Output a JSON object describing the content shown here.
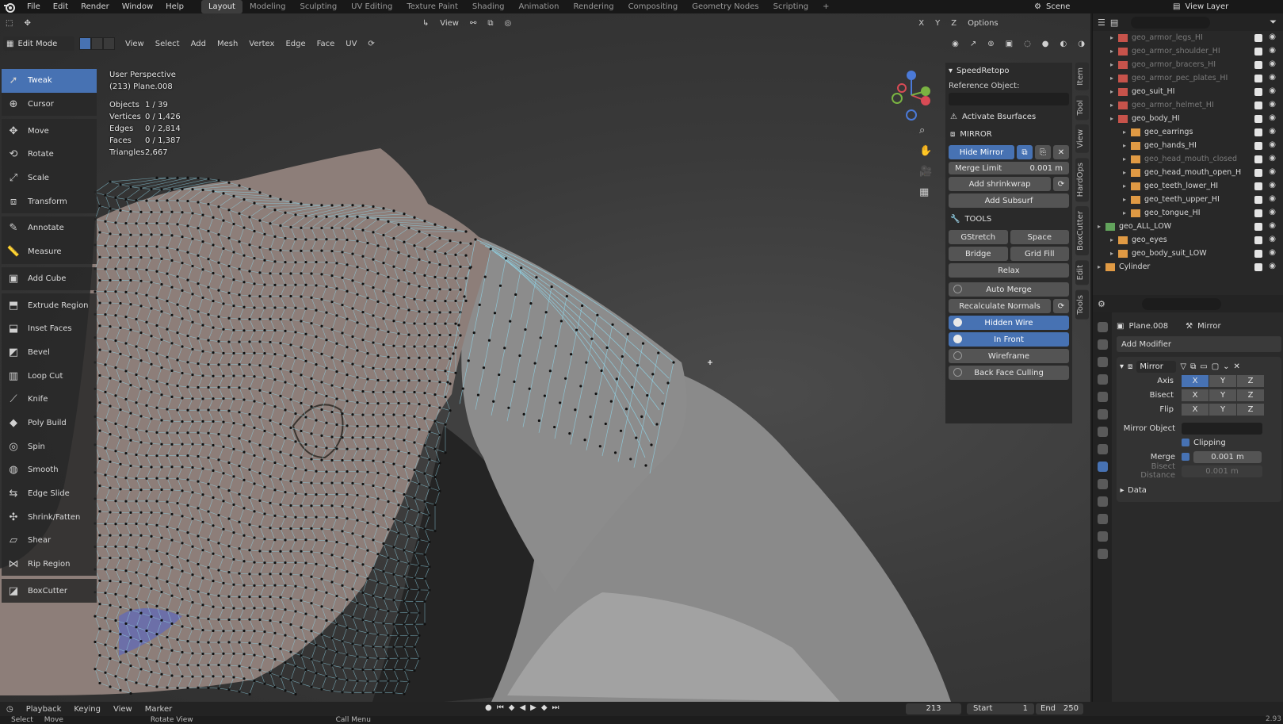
{
  "topbar": {
    "menus": [
      "File",
      "Edit",
      "Render",
      "Window",
      "Help"
    ],
    "workspaces": [
      "Layout",
      "Modeling",
      "Sculpting",
      "UV Editing",
      "Texture Paint",
      "Shading",
      "Animation",
      "Rendering",
      "Compositing",
      "Geometry Nodes",
      "Scripting"
    ],
    "active_workspace": "Layout",
    "scene": "Scene",
    "view_layer": "View Layer"
  },
  "viewport_header": {
    "mode": "Edit Mode",
    "menus": [
      "View",
      "Select",
      "Add",
      "Mesh",
      "Vertex",
      "Edge",
      "Face",
      "UV"
    ],
    "orientation": "View",
    "axes": [
      "X",
      "Y",
      "Z"
    ],
    "options_label": "Options"
  },
  "viewport_info": {
    "perspective": "User Perspective",
    "object_name": "(213) Plane.008",
    "stats": [
      {
        "label": "Objects",
        "value": "1 / 39"
      },
      {
        "label": "Vertices",
        "value": "0 / 1,426"
      },
      {
        "label": "Edges",
        "value": "0 / 2,814"
      },
      {
        "label": "Faces",
        "value": "0 / 1,387"
      },
      {
        "label": "Triangles",
        "value": "2,667"
      }
    ]
  },
  "toolbar": {
    "tools": [
      "Tweak",
      "Cursor",
      "Move",
      "Rotate",
      "Scale",
      "Transform",
      "Annotate",
      "Measure",
      "Add Cube",
      "Extrude Region",
      "Inset Faces",
      "Bevel",
      "Loop Cut",
      "Knife",
      "Poly Build",
      "Spin",
      "Smooth",
      "Edge Slide",
      "Shrink/Fatten",
      "Shear",
      "Rip Region",
      "BoxCutter"
    ],
    "active": "Tweak"
  },
  "npanel": {
    "title": "SpeedRetopo",
    "reference_label": "Reference Object:",
    "activate_label": "Activate Bsurfaces",
    "mirror_title": "MIRROR",
    "hide_mirror": "Hide Mirror",
    "merge_limit_label": "Merge Limit",
    "merge_limit_value": "0.001 m",
    "add_shrinkwrap": "Add shrinkwrap",
    "add_subsurf": "Add Subsurf",
    "tools_title": "TOOLS",
    "gstretch": "GStretch",
    "space": "Space",
    "bridge": "Bridge",
    "grid_fill": "Grid Fill",
    "relax": "Relax",
    "auto_merge": "Auto Merge",
    "recalc_normals": "Recalculate Normals",
    "hidden_wire": "Hidden Wire",
    "in_front": "In Front",
    "wireframe": "Wireframe",
    "back_face_culling": "Back Face Culling",
    "side_tabs": [
      "Item",
      "Tool",
      "View",
      "HardOps",
      "BoxCutter",
      "Edit",
      "Tools"
    ]
  },
  "outliner": {
    "rows": [
      {
        "name": "geo_armor_legs_HI",
        "dim": true,
        "indent": 1
      },
      {
        "name": "geo_armor_shoulder_HI",
        "dim": true,
        "indent": 1
      },
      {
        "name": "geo_armor_bracers_HI",
        "dim": true,
        "indent": 1
      },
      {
        "name": "geo_armor_pec_plates_HI",
        "dim": true,
        "indent": 1
      },
      {
        "name": "geo_suit_HI",
        "dim": false,
        "indent": 1
      },
      {
        "name": "geo_armor_helmet_HI",
        "dim": true,
        "indent": 1
      },
      {
        "name": "geo_body_HI",
        "dim": false,
        "indent": 1
      },
      {
        "name": "geo_earrings",
        "dim": false,
        "indent": 2
      },
      {
        "name": "geo_hands_HI",
        "dim": false,
        "indent": 2
      },
      {
        "name": "geo_head_mouth_closed",
        "dim": true,
        "indent": 2
      },
      {
        "name": "geo_head_mouth_open_H",
        "dim": false,
        "indent": 2
      },
      {
        "name": "geo_teeth_lower_HI",
        "dim": false,
        "indent": 2
      },
      {
        "name": "geo_teeth_upper_HI",
        "dim": false,
        "indent": 2
      },
      {
        "name": "geo_tongue_HI",
        "dim": false,
        "indent": 2
      },
      {
        "name": "geo_ALL_LOW",
        "dim": false,
        "indent": 0
      },
      {
        "name": "geo_eyes",
        "dim": false,
        "indent": 1
      },
      {
        "name": "geo_body_suit_LOW",
        "dim": false,
        "indent": 1
      },
      {
        "name": "Cylinder",
        "dim": false,
        "indent": 0
      }
    ]
  },
  "properties": {
    "object": "Plane.008",
    "modifier_tab": "Mirror",
    "add_modifier": "Add Modifier",
    "modifier_name": "Mirror",
    "axis_label": "Axis",
    "bisect_label": "Bisect",
    "flip_label": "Flip",
    "axes": [
      "X",
      "Y",
      "Z"
    ],
    "mirror_object_label": "Mirror Object",
    "clipping_label": "Clipping",
    "merge_label": "Merge",
    "merge_value": "0.001 m",
    "bisect_distance_label": "Bisect Distance",
    "bisect_distance_value": "0.001 m",
    "data_label": "Data"
  },
  "timeline": {
    "menus": [
      "Playback",
      "Keying",
      "View",
      "Marker"
    ],
    "current_frame": "213",
    "start_label": "Start",
    "start_value": "1",
    "end_label": "End",
    "end_value": "250"
  },
  "statusbar": {
    "items": [
      "Select",
      "Move",
      "Rotate View",
      "Call Menu"
    ],
    "version": "2.93"
  },
  "colors": {
    "accent": "#4772b3",
    "wire": "#8fd3e6",
    "vertex": "#111111"
  }
}
